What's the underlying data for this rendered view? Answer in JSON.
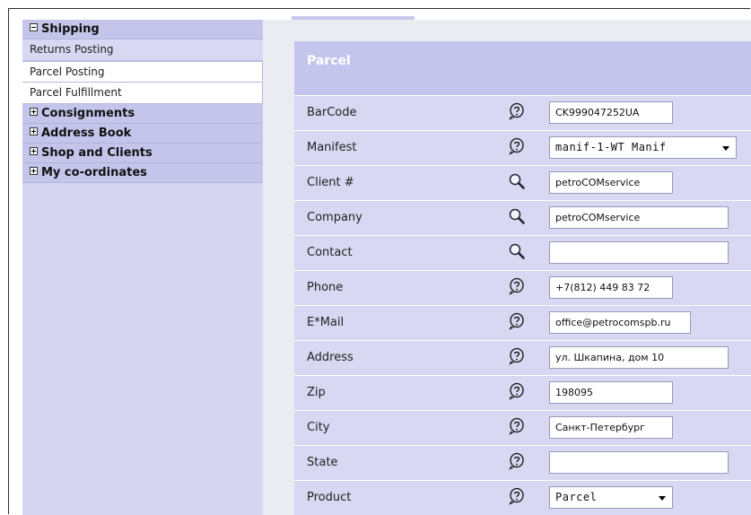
{
  "sidebar": {
    "shipping": "Shipping",
    "returns_posting": "Returns Posting",
    "parcel_posting": "Parcel Posting",
    "parcel_fulfillment": "Parcel Fulfillment",
    "consignments": "Consignments",
    "address_book": "Address Book",
    "shop_and_clients": "Shop and Clients",
    "my_coordinates": "My co-ordinates"
  },
  "panel": {
    "title": "Parcel"
  },
  "fields": [
    {
      "label": "BarCode",
      "icon": "help-icon",
      "value": "CK999047252UA",
      "type": "input"
    },
    {
      "label": "Manifest",
      "icon": "help-icon",
      "value": "manif-1-WT Manif",
      "type": "select"
    },
    {
      "label": "Client #",
      "icon": "search-icon",
      "value": "petroCOMservice",
      "type": "input"
    },
    {
      "label": "Company",
      "icon": "search-icon",
      "value": "petroCOMservice",
      "type": "input"
    },
    {
      "label": "Contact",
      "icon": "search-icon",
      "value": "",
      "type": "input"
    },
    {
      "label": "Phone",
      "icon": "help-icon",
      "value": "+7(812) 449 83 72",
      "type": "input"
    },
    {
      "label": "E*Mail",
      "icon": "help-icon",
      "value": "office@petrocomspb.ru",
      "type": "input"
    },
    {
      "label": "Address",
      "icon": "help-icon",
      "value": "ул. Шкапина, дом 10",
      "type": "input"
    },
    {
      "label": "Zip",
      "icon": "help-icon",
      "value": "198095",
      "type": "input"
    },
    {
      "label": "City",
      "icon": "help-icon",
      "value": "Санкт-Петербург",
      "type": "input"
    },
    {
      "label": "State",
      "icon": "help-icon",
      "value": "",
      "type": "input"
    },
    {
      "label": "Product",
      "icon": "help-icon",
      "value": "Parcel",
      "type": "select"
    }
  ]
}
